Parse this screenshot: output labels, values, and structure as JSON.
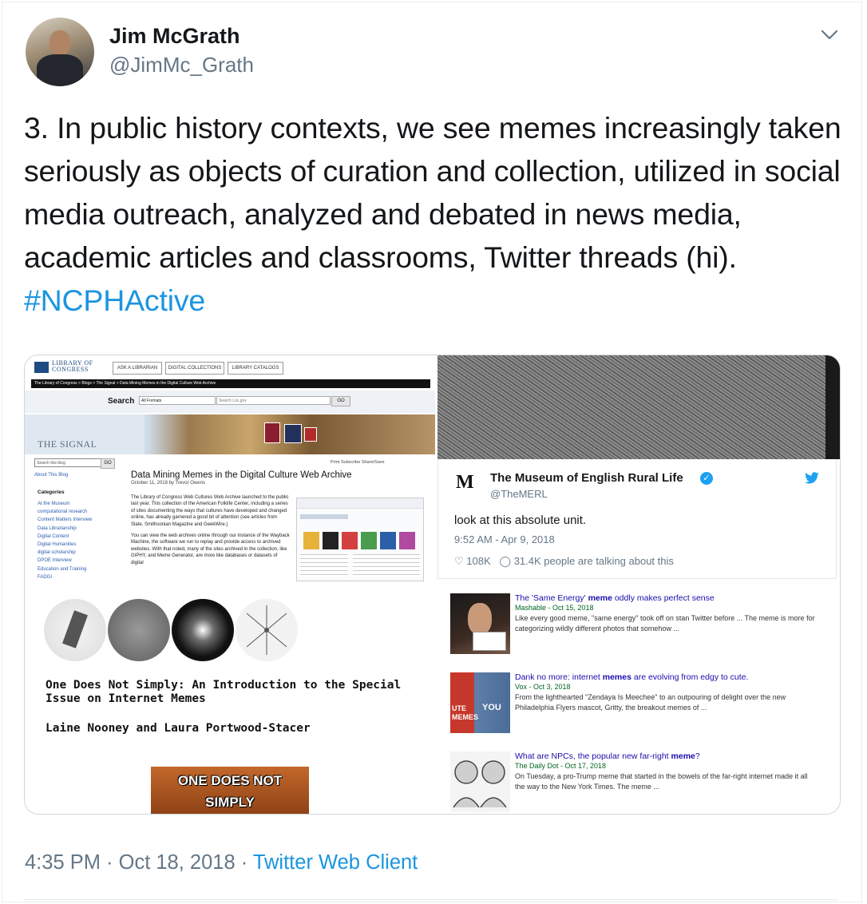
{
  "author": {
    "name": "Jim McGrath",
    "handle": "@JimMc_Grath"
  },
  "tweet": {
    "text": "3. In public history contexts, we see memes increasingly taken seriously as objects of curation and collection, utilized in social media outreach, analyzed and debated in news media, academic articles and classrooms, Twitter threads (hi).",
    "hashtag": "#NCPHActive"
  },
  "media": {
    "loc": {
      "logo_line1": "LIBRARY OF",
      "logo_line2": "CONGRESS",
      "buttons": [
        "ASK A LIBRARIAN",
        "DIGITAL COLLECTIONS",
        "LIBRARY CATALOGS"
      ],
      "breadcrumb": "The Library of Congress > Blogs > The Signal > Data Mining Memes in the Digital Culture Web Archive",
      "search_label": "Search",
      "search_select": "All Formats",
      "search_placeholder": "Search Loc.gov",
      "search_go": "GO",
      "blog_name": "THE SIGNAL",
      "side_search_placeholder": "Search this blog",
      "side_go": "GO",
      "about_link": "About This Blog",
      "categories_heading": "Categories",
      "categories": [
        "At the Museum",
        "computational research",
        "Content Matters Interview",
        "Data Librarianship",
        "Digital Content",
        "Digital Humanities",
        "digital scholarship",
        "DPOE Interview",
        "Education and Training",
        "FADGI"
      ],
      "tools": "Print  Subscribe  Share/Save",
      "article_title": "Data Mining Memes in the Digital Culture Web Archive",
      "article_date": "October 11, 2018 by Trevor Owens",
      "article_p1": "The Library of Congress Web Cultures Web Archive launched to the public last year. This collection of the American Folklife Center, including a series of sites documenting the ways that cultures have developed and changed online, has already garnered a good bit of attention (see articles from Slate, Smithsonian Magazine and GeekWire.)",
      "article_p2": "You can view the web archives online through our instance of the Wayback Machine, the software we run to replay and provide access to archived websites. With that noted, many of the sites archived in the collection, like GIPHY, and Meme Generator, are more like databases or datasets of digital"
    },
    "paper": {
      "title_line1": "One Does Not Simply: An Introduction to the Special",
      "title_line2": "Issue on Internet Memes",
      "authors": "Laine Nooney and Laura Portwood-Stacer",
      "meme_line1": "ONE DOES NOT",
      "meme_line2": "SIMPLY"
    },
    "merl": {
      "logo": "M",
      "name": "The Museum of English Rural Life",
      "handle": "@TheMERL",
      "text": "look at this absolute unit.",
      "time": "9:52 AM - Apr 9, 2018",
      "likes": "108K",
      "talking": "31.4K people are talking about this"
    },
    "news": [
      {
        "title_pre": "The 'Same Energy' ",
        "title_bold": "meme",
        "title_post": " oddly makes perfect sense",
        "source": "Mashable - Oct 15, 2018",
        "desc": "Like every good meme, \"same energy\" took off on stan Twitter before ... The meme is more for categorizing wildly different photos that somehow ..."
      },
      {
        "title_pre": "Dank no more: internet ",
        "title_bold": "memes",
        "title_post": " are evolving from edgy to cute.",
        "source": "Vox - Oct 3, 2018",
        "desc": "From the lighthearted \"Zendaya Is Meechee\" to an outpouring of delight over the new Philadelphia Flyers mascot, Gritty, the breakout memes of ...",
        "thumb_left": "UTE",
        "thumb_left2": "MEMES",
        "thumb_right": "YOU"
      },
      {
        "title_pre": "What are NPCs, the popular new far-right ",
        "title_bold": "meme",
        "title_post": "?",
        "source": "The Daily Dot - Oct 17, 2018",
        "desc": "On Tuesday, a pro-Trump meme that started in the bowels of the far-right internet made it all the way to the New York Times. The meme ..."
      }
    ]
  },
  "footer": {
    "timestamp": "4:35 PM · Oct 18, 2018 · ",
    "client": "Twitter Web Client"
  }
}
